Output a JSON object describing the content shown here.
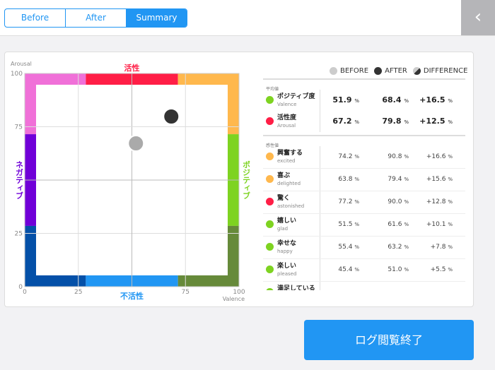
{
  "tabs": [
    {
      "label": "Before"
    },
    {
      "label": "After"
    },
    {
      "label": "Summary",
      "active": true
    }
  ],
  "back_icon": "chevron-left-icon",
  "chart_data": {
    "type": "scatter",
    "xlabel": "Valence",
    "ylabel": "Arousal",
    "xlim": [
      0,
      100
    ],
    "ylim": [
      0,
      100
    ],
    "xticks": [
      "0",
      "25",
      "75",
      "100"
    ],
    "yticks": [
      "0",
      "25",
      "75",
      "100"
    ],
    "grid": true,
    "zone_labels": {
      "top": "活性",
      "bottom": "不活性",
      "left": "ネガティブ",
      "right": "ポジティブ"
    },
    "points": [
      {
        "name": "BEFORE",
        "x": 51.9,
        "y": 67.2,
        "color": "#aaaaaa"
      },
      {
        "name": "AFTER",
        "x": 68.4,
        "y": 79.8,
        "color": "#333333"
      }
    ]
  },
  "legend": [
    {
      "label": "BEFORE",
      "color": "#cccccc"
    },
    {
      "label": "AFTER",
      "color": "#333333"
    },
    {
      "label": "DIFFERENCE",
      "color": "half"
    }
  ],
  "sections": {
    "average": "平均値",
    "emotion": "感性値"
  },
  "average_rows": [
    {
      "jp": "ポジティブ度",
      "en": "Valence",
      "color": "#7ed321",
      "before": "51.9",
      "after": "68.4",
      "diff": "+16.5"
    },
    {
      "jp": "活性度",
      "en": "Arousal",
      "color": "#ff1e46",
      "before": "67.2",
      "after": "79.8",
      "diff": "+12.5"
    }
  ],
  "emotion_rows": [
    {
      "jp": "興奮する",
      "en": "excited",
      "color": "#ffb84d",
      "before": "74.2",
      "after": "90.8",
      "diff": "+16.6"
    },
    {
      "jp": "喜ぶ",
      "en": "delighted",
      "color": "#ffb84d",
      "before": "63.8",
      "after": "79.4",
      "diff": "+15.6"
    },
    {
      "jp": "驚く",
      "en": "astonished",
      "color": "#ff1e46",
      "before": "77.2",
      "after": "90.0",
      "diff": "+12.8"
    },
    {
      "jp": "嬉しい",
      "en": "glad",
      "color": "#7ed321",
      "before": "51.5",
      "after": "61.6",
      "diff": "+10.1"
    },
    {
      "jp": "幸せな",
      "en": "happy",
      "color": "#7ed321",
      "before": "55.4",
      "after": "63.2",
      "diff": "+7.8"
    },
    {
      "jp": "楽しい",
      "en": "pleased",
      "color": "#7ed321",
      "before": "45.4",
      "after": "51.0",
      "diff": "+5.5"
    },
    {
      "jp": "満足している",
      "en": "",
      "color": "#7ed321",
      "before": "",
      "after": "",
      "diff": ""
    }
  ],
  "unit": "%",
  "end_button": "ログ閲覧終了"
}
